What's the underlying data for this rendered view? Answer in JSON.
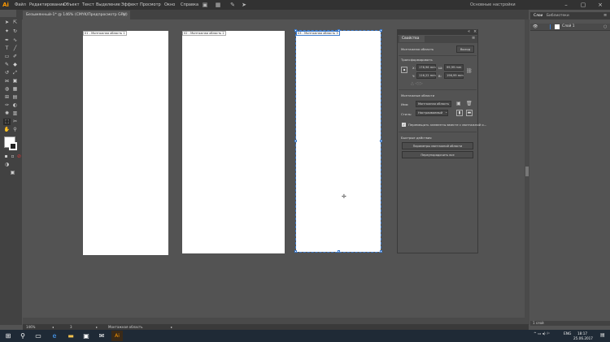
{
  "app": {
    "logo": "Ai"
  },
  "menu": [
    "Файл",
    "Редактирование",
    "Объект",
    "Текст",
    "Выделение",
    "Эффект",
    "Просмотр",
    "Окно",
    "Справка"
  ],
  "workspace": "Основные настройки",
  "document_tab": {
    "title": "Безымянный-1* @ 146% (CMYK/Предпросмотр GPU)",
    "close": "×"
  },
  "window_controls": [
    "–",
    "▢",
    "×"
  ],
  "artboards": [
    {
      "label": "01 - Монтажная область 1"
    },
    {
      "label": "02 - Монтажная область 2"
    },
    {
      "label": "03 - Монтажная область 3"
    }
  ],
  "properties": {
    "tab": "Свойства",
    "artboard_label": "Монтажная область",
    "exit_button": "Выход",
    "transform_header": "Трансформировать",
    "x_label": "X:",
    "x_value": "178,96 mm",
    "y_label": "Y:",
    "y_value": "116,22 mm",
    "w_label": "Ш:",
    "w_value": "99,99 mm",
    "h_label": "В:",
    "h_value": "196,99 mm",
    "artboards_header": "Монтажные области",
    "preset_label": "Имя:",
    "preset_value": "Монтажная область",
    "size_label": "Стиль:",
    "size_value": "Настраиваемый",
    "move_checkbox": "Перемещать элементы вместе с монтажной о...",
    "quick_actions": "Быстрые действия",
    "artboard_options_button": "Параметры монтажной области",
    "rearrange_button": "Переупорядочить все"
  },
  "layers": {
    "tab1": "Слои",
    "tab2": "Библиотеки",
    "layer_name": "Слой 1",
    "count": "1 слой"
  },
  "status": {
    "zoom": "146%",
    "artboard_index": "3",
    "status_text": "Монтажная область"
  },
  "taskbar": {
    "time": "18:17",
    "date": "25.06.2017",
    "lang": "ENG"
  }
}
